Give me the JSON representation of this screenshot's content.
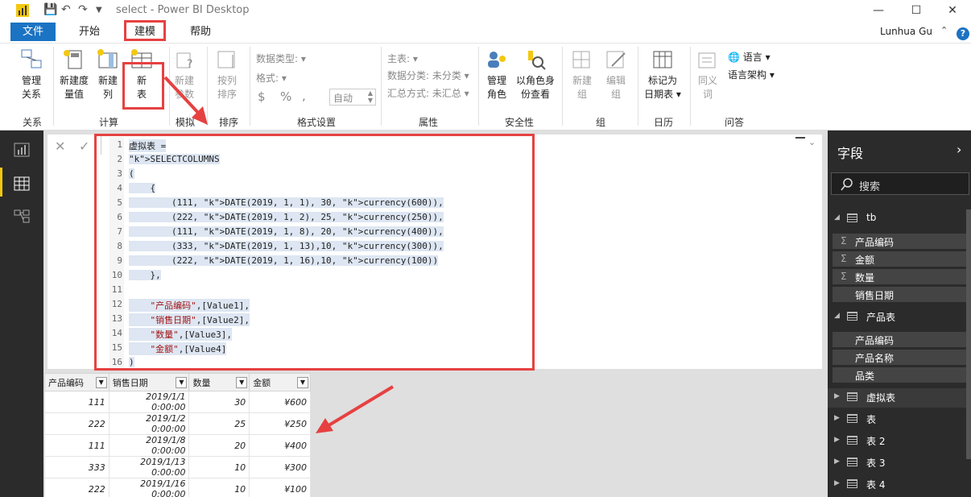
{
  "window": {
    "title": "select - Power BI Desktop",
    "minimize": "—",
    "maximize": "☐",
    "close": "✕"
  },
  "menu": {
    "file": "文件",
    "start": "开始",
    "model": "建模",
    "help": "帮助",
    "user": "Lunhua Gu",
    "help_icon": "?"
  },
  "ribbon": {
    "manage_rel": "管理\n关系",
    "new_measure": "新建度\n量值",
    "new_col": "新建\n列",
    "new_table": "新\n表",
    "new_param": "新建\n参数",
    "sort_by": "按列\n排序",
    "data_type": "数据类型:",
    "format": "格式:",
    "currency": "$",
    "percent": "%",
    "comma": ",",
    "auto": "自动",
    "home_table": "主表:",
    "data_cat": "数据分类: 未分类",
    "summarize": "汇总方式: 未汇总",
    "manage_roles": "管理\n角色",
    "view_as": "以角色身\n份查看",
    "new_group": "新建\n组",
    "edit_group": "编辑\n组",
    "mark_date": "标记为\n日期表",
    "synonyms": "同义\n词",
    "language": "语言",
    "lang_schema": "语言架构",
    "groups": {
      "rel": "关系",
      "calc": "计算",
      "what_if": "模拟",
      "sort": "排序",
      "format": "格式设置",
      "props": "属性",
      "security": "安全性",
      "group": "组",
      "calendar": "日历",
      "qa": "问答"
    }
  },
  "editor": {
    "lines": [
      {
        "n": "1",
        "t": "虚拟表 ="
      },
      {
        "n": "2",
        "t": "SELECTCOLUMNS"
      },
      {
        "n": "3",
        "t": "("
      },
      {
        "n": "4",
        "t": "    {"
      },
      {
        "n": "5",
        "t": "        (111, DATE(2019, 1, 1), 30, currency(600)),"
      },
      {
        "n": "6",
        "t": "        (222, DATE(2019, 1, 2), 25, currency(250)),"
      },
      {
        "n": "7",
        "t": "        (111, DATE(2019, 1, 8), 20, currency(400)),"
      },
      {
        "n": "8",
        "t": "        (333, DATE(2019, 1, 13),10, currency(300)),"
      },
      {
        "n": "9",
        "t": "        (222, DATE(2019, 1, 16),10, currency(100))"
      },
      {
        "n": "10",
        "t": "    },"
      },
      {
        "n": "11",
        "t": ""
      },
      {
        "n": "12",
        "t": "    \"产品编码\",[Value1],"
      },
      {
        "n": "13",
        "t": "    \"销售日期\",[Value2],"
      },
      {
        "n": "14",
        "t": "    \"数量\",[Value3],"
      },
      {
        "n": "15",
        "t": "    \"金额\",[Value4]"
      },
      {
        "n": "16",
        "t": ")"
      }
    ]
  },
  "table": {
    "headers": [
      "产品编码",
      "销售日期",
      "数量",
      "金额"
    ],
    "rows": [
      [
        "111",
        "2019/1/1 0:00:00",
        "30",
        "¥600"
      ],
      [
        "222",
        "2019/1/2 0:00:00",
        "25",
        "¥250"
      ],
      [
        "111",
        "2019/1/8 0:00:00",
        "20",
        "¥400"
      ],
      [
        "333",
        "2019/1/13 0:00:00",
        "10",
        "¥300"
      ],
      [
        "222",
        "2019/1/16 0:00:00",
        "10",
        "¥100"
      ]
    ]
  },
  "fields": {
    "title": "字段",
    "search": "搜索",
    "tb": {
      "name": "tb",
      "fields": [
        "产品编码",
        "金额",
        "数量",
        "销售日期"
      ]
    },
    "product": {
      "name": "产品表",
      "fields": [
        "产品编码",
        "产品名称",
        "品类"
      ]
    },
    "tables": [
      "虚拟表",
      "表",
      "表 2",
      "表 3",
      "表 4"
    ],
    "sigma": "Σ"
  }
}
